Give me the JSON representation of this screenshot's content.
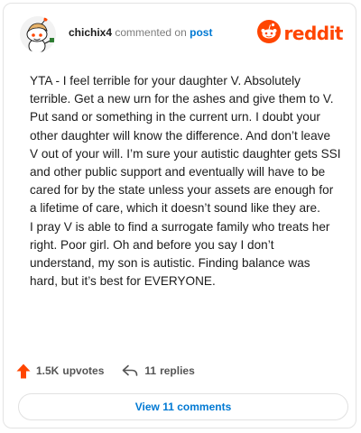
{
  "header": {
    "username": "chichix4",
    "action_text": "commented on",
    "post_link": "post",
    "brand_name": "reddit",
    "avatar_icon": "snoo-avatar-icon",
    "brand_icon": "reddit-snoo-icon"
  },
  "comment": {
    "paragraphs": [
      "YTA - I feel terrible for your daughter V. Absolutely terrible. Get a new urn for the ashes and give them to V. Put sand or something in the current urn. I doubt your other daughter will know the difference. And don’t leave V out of your will. I’m sure your autistic daughter gets SSI and other public support and eventually will have to be cared for by the state unless your assets are enough for a lifetime of care, which it doesn’t sound like they are.",
      "I pray V is able to find a surrogate family who treats her right. Poor girl. Oh and before you say I don’t understand, my son is autistic. Finding balance was hard, but it’s best for EVERYONE."
    ]
  },
  "actions": {
    "upvotes_count": "1.5K",
    "upvotes_label": "upvotes",
    "replies_count": "11",
    "replies_label": "replies",
    "upvote_icon": "upvote-arrow-icon",
    "reply_icon": "reply-arrow-icon"
  },
  "footer": {
    "view_comments_label": "View 11 comments"
  },
  "colors": {
    "brand": "#ff4500",
    "link": "#0079d3",
    "text": "#1c1c1c",
    "muted": "#7c7c7c"
  }
}
